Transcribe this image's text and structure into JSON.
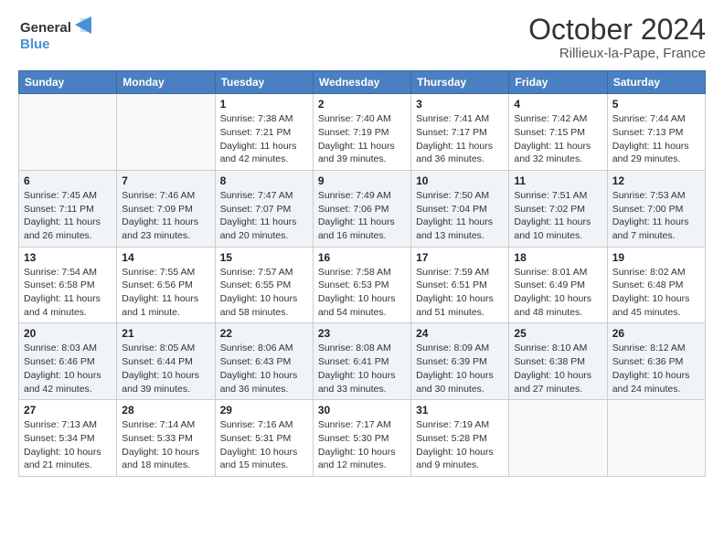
{
  "logo": {
    "line1": "General",
    "line2": "Blue"
  },
  "title": "October 2024",
  "location": "Rillieux-la-Pape, France",
  "weekdays": [
    "Sunday",
    "Monday",
    "Tuesday",
    "Wednesday",
    "Thursday",
    "Friday",
    "Saturday"
  ],
  "weeks": [
    [
      {
        "day": null
      },
      {
        "day": null
      },
      {
        "day": "1",
        "sunrise": "Sunrise: 7:38 AM",
        "sunset": "Sunset: 7:21 PM",
        "daylight": "Daylight: 11 hours and 42 minutes."
      },
      {
        "day": "2",
        "sunrise": "Sunrise: 7:40 AM",
        "sunset": "Sunset: 7:19 PM",
        "daylight": "Daylight: 11 hours and 39 minutes."
      },
      {
        "day": "3",
        "sunrise": "Sunrise: 7:41 AM",
        "sunset": "Sunset: 7:17 PM",
        "daylight": "Daylight: 11 hours and 36 minutes."
      },
      {
        "day": "4",
        "sunrise": "Sunrise: 7:42 AM",
        "sunset": "Sunset: 7:15 PM",
        "daylight": "Daylight: 11 hours and 32 minutes."
      },
      {
        "day": "5",
        "sunrise": "Sunrise: 7:44 AM",
        "sunset": "Sunset: 7:13 PM",
        "daylight": "Daylight: 11 hours and 29 minutes."
      }
    ],
    [
      {
        "day": "6",
        "sunrise": "Sunrise: 7:45 AM",
        "sunset": "Sunset: 7:11 PM",
        "daylight": "Daylight: 11 hours and 26 minutes."
      },
      {
        "day": "7",
        "sunrise": "Sunrise: 7:46 AM",
        "sunset": "Sunset: 7:09 PM",
        "daylight": "Daylight: 11 hours and 23 minutes."
      },
      {
        "day": "8",
        "sunrise": "Sunrise: 7:47 AM",
        "sunset": "Sunset: 7:07 PM",
        "daylight": "Daylight: 11 hours and 20 minutes."
      },
      {
        "day": "9",
        "sunrise": "Sunrise: 7:49 AM",
        "sunset": "Sunset: 7:06 PM",
        "daylight": "Daylight: 11 hours and 16 minutes."
      },
      {
        "day": "10",
        "sunrise": "Sunrise: 7:50 AM",
        "sunset": "Sunset: 7:04 PM",
        "daylight": "Daylight: 11 hours and 13 minutes."
      },
      {
        "day": "11",
        "sunrise": "Sunrise: 7:51 AM",
        "sunset": "Sunset: 7:02 PM",
        "daylight": "Daylight: 11 hours and 10 minutes."
      },
      {
        "day": "12",
        "sunrise": "Sunrise: 7:53 AM",
        "sunset": "Sunset: 7:00 PM",
        "daylight": "Daylight: 11 hours and 7 minutes."
      }
    ],
    [
      {
        "day": "13",
        "sunrise": "Sunrise: 7:54 AM",
        "sunset": "Sunset: 6:58 PM",
        "daylight": "Daylight: 11 hours and 4 minutes."
      },
      {
        "day": "14",
        "sunrise": "Sunrise: 7:55 AM",
        "sunset": "Sunset: 6:56 PM",
        "daylight": "Daylight: 11 hours and 1 minute."
      },
      {
        "day": "15",
        "sunrise": "Sunrise: 7:57 AM",
        "sunset": "Sunset: 6:55 PM",
        "daylight": "Daylight: 10 hours and 58 minutes."
      },
      {
        "day": "16",
        "sunrise": "Sunrise: 7:58 AM",
        "sunset": "Sunset: 6:53 PM",
        "daylight": "Daylight: 10 hours and 54 minutes."
      },
      {
        "day": "17",
        "sunrise": "Sunrise: 7:59 AM",
        "sunset": "Sunset: 6:51 PM",
        "daylight": "Daylight: 10 hours and 51 minutes."
      },
      {
        "day": "18",
        "sunrise": "Sunrise: 8:01 AM",
        "sunset": "Sunset: 6:49 PM",
        "daylight": "Daylight: 10 hours and 48 minutes."
      },
      {
        "day": "19",
        "sunrise": "Sunrise: 8:02 AM",
        "sunset": "Sunset: 6:48 PM",
        "daylight": "Daylight: 10 hours and 45 minutes."
      }
    ],
    [
      {
        "day": "20",
        "sunrise": "Sunrise: 8:03 AM",
        "sunset": "Sunset: 6:46 PM",
        "daylight": "Daylight: 10 hours and 42 minutes."
      },
      {
        "day": "21",
        "sunrise": "Sunrise: 8:05 AM",
        "sunset": "Sunset: 6:44 PM",
        "daylight": "Daylight: 10 hours and 39 minutes."
      },
      {
        "day": "22",
        "sunrise": "Sunrise: 8:06 AM",
        "sunset": "Sunset: 6:43 PM",
        "daylight": "Daylight: 10 hours and 36 minutes."
      },
      {
        "day": "23",
        "sunrise": "Sunrise: 8:08 AM",
        "sunset": "Sunset: 6:41 PM",
        "daylight": "Daylight: 10 hours and 33 minutes."
      },
      {
        "day": "24",
        "sunrise": "Sunrise: 8:09 AM",
        "sunset": "Sunset: 6:39 PM",
        "daylight": "Daylight: 10 hours and 30 minutes."
      },
      {
        "day": "25",
        "sunrise": "Sunrise: 8:10 AM",
        "sunset": "Sunset: 6:38 PM",
        "daylight": "Daylight: 10 hours and 27 minutes."
      },
      {
        "day": "26",
        "sunrise": "Sunrise: 8:12 AM",
        "sunset": "Sunset: 6:36 PM",
        "daylight": "Daylight: 10 hours and 24 minutes."
      }
    ],
    [
      {
        "day": "27",
        "sunrise": "Sunrise: 7:13 AM",
        "sunset": "Sunset: 5:34 PM",
        "daylight": "Daylight: 10 hours and 21 minutes."
      },
      {
        "day": "28",
        "sunrise": "Sunrise: 7:14 AM",
        "sunset": "Sunset: 5:33 PM",
        "daylight": "Daylight: 10 hours and 18 minutes."
      },
      {
        "day": "29",
        "sunrise": "Sunrise: 7:16 AM",
        "sunset": "Sunset: 5:31 PM",
        "daylight": "Daylight: 10 hours and 15 minutes."
      },
      {
        "day": "30",
        "sunrise": "Sunrise: 7:17 AM",
        "sunset": "Sunset: 5:30 PM",
        "daylight": "Daylight: 10 hours and 12 minutes."
      },
      {
        "day": "31",
        "sunrise": "Sunrise: 7:19 AM",
        "sunset": "Sunset: 5:28 PM",
        "daylight": "Daylight: 10 hours and 9 minutes."
      },
      {
        "day": null
      },
      {
        "day": null
      }
    ]
  ]
}
